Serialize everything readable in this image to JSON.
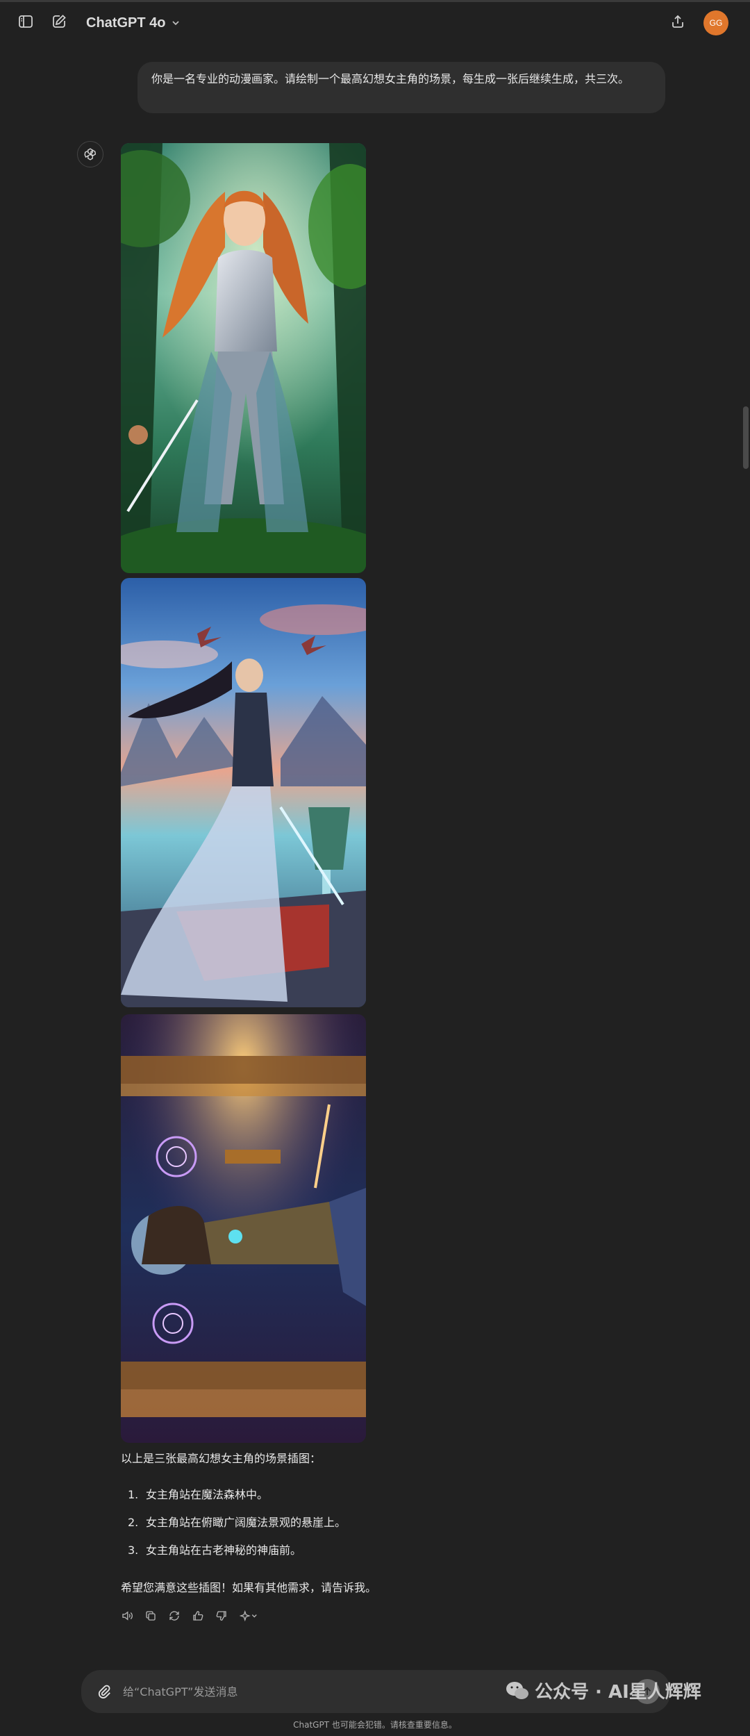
{
  "header": {
    "model_label": "ChatGPT 4o",
    "avatar_initials": "GG",
    "icons": [
      "sidebar-toggle-icon",
      "new-chat-icon",
      "chevron-down-icon",
      "share-icon"
    ]
  },
  "conversation": {
    "user_message": "你是一名专业的动漫画家。请绘制一个最高幻想女主角的场景，每生成一张后继续生成，共三次。",
    "assistant": {
      "images": [
        {
          "scene": "forest"
        },
        {
          "scene": "cliff"
        },
        {
          "scene": "temple"
        }
      ],
      "intro": "以上是三张最高幻想女主角的场景插图：",
      "list": [
        {
          "num": "1.",
          "text": "女主角站在魔法森林中。"
        },
        {
          "num": "2.",
          "text": "女主角站在俯瞰广阔魔法景观的悬崖上。"
        },
        {
          "num": "3.",
          "text": "女主角站在古老神秘的神庙前。"
        }
      ],
      "outro": "希望您满意这些插图！如果有其他需求，请告诉我。",
      "action_icons": [
        "read-aloud-icon",
        "copy-icon",
        "regenerate-icon",
        "thumbs-up-icon",
        "thumbs-down-icon",
        "sparkle-model-icon"
      ]
    }
  },
  "composer": {
    "placeholder": "给“ChatGPT”发送消息"
  },
  "footer": {
    "disclaimer": "ChatGPT 也可能会犯错。请核查重要信息。"
  },
  "watermark": {
    "text": "公众号 · AI星人辉辉"
  },
  "colors": {
    "background": "#212121",
    "bubble": "#2f2f2f",
    "avatar": "#e0772c",
    "text": "#ececec"
  }
}
